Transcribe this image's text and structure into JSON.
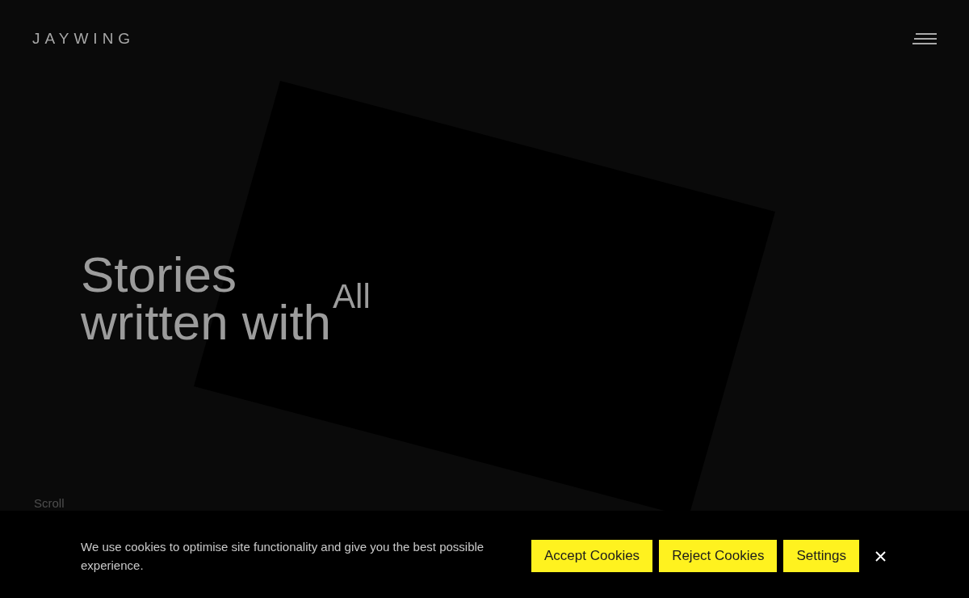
{
  "header": {
    "logo": "JAYWING"
  },
  "hero": {
    "headline_lines": [
      "Stories",
      "written with"
    ],
    "rotating_word": "All",
    "scroll_hint": "Scroll"
  },
  "cookie_banner": {
    "message": "We use cookies to optimise site functionality and give you the best possible experience.",
    "buttons": [
      "Accept Cookies",
      "Reject Cookies",
      "Settings"
    ]
  }
}
